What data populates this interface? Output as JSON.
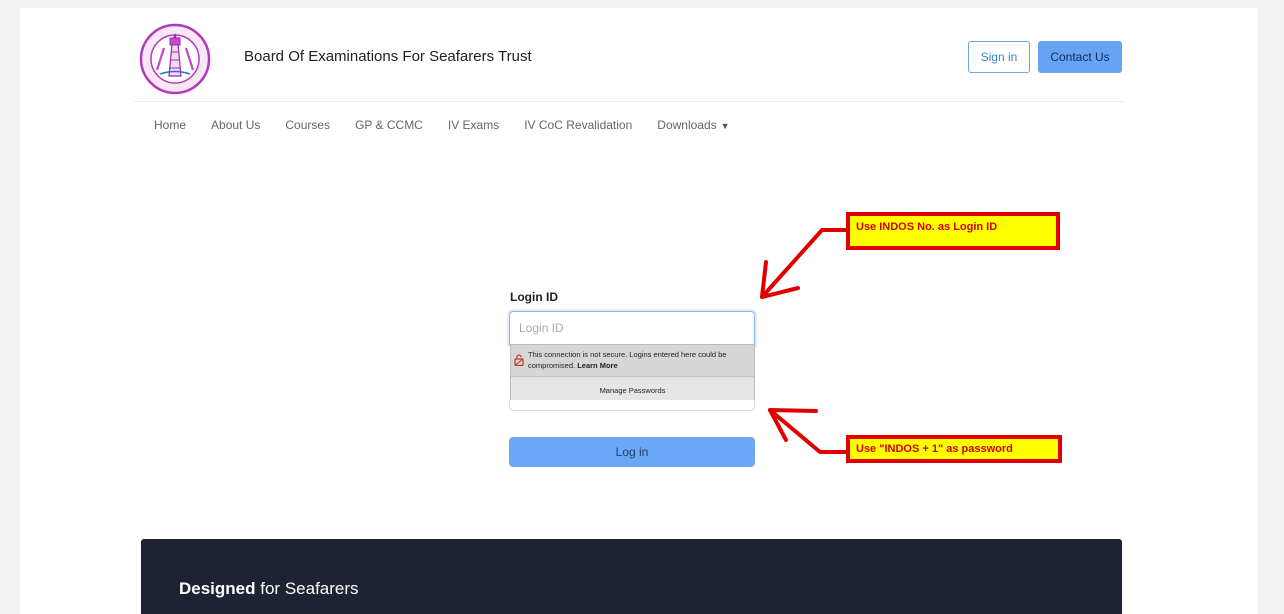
{
  "header": {
    "site_title": "Board Of Examinations For Seafarers Trust",
    "signin_label": "Sign in",
    "contact_label": "Contact Us"
  },
  "nav": {
    "items": [
      "Home",
      "About Us",
      "Courses",
      "GP & CCMC",
      "IV Exams",
      "IV CoC Revalidation",
      "Downloads"
    ]
  },
  "login": {
    "label": "Login ID",
    "placeholder": "Login ID",
    "button_label": "Log in"
  },
  "autofill_popup": {
    "warning_text": "This connection is not secure. Logins entered here could be compromised.",
    "learn_more": "Learn More",
    "manage_passwords": "Manage Passwords"
  },
  "annotations": {
    "callout_login_id": "Use INDOS No. as Login ID",
    "callout_password": "Use \"INDOS + 1\" as password"
  },
  "footer": {
    "title_bold": "Designed",
    "title_rest": " for Seafarers"
  },
  "colors": {
    "primary_button": "#66a3f5",
    "callout_fill": "#ffff00",
    "callout_border": "#e00000",
    "footer_bg": "#1e2333"
  }
}
